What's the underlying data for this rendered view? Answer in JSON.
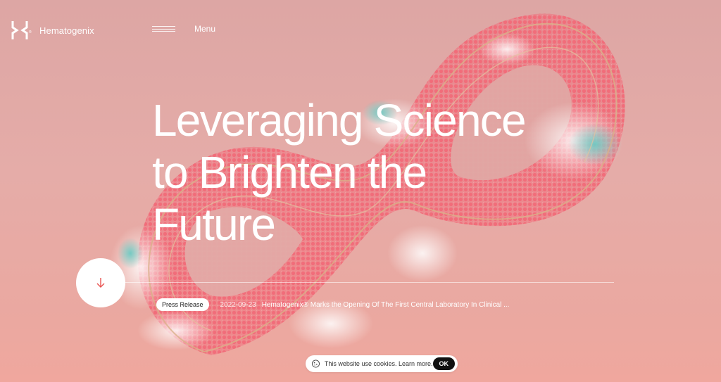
{
  "brand": {
    "name": "Hematogenix"
  },
  "nav": {
    "menu_label": "Menu",
    "menu_icon": "hamburger-icon"
  },
  "hero": {
    "title_lines": [
      "Leveraging Science",
      "to Brighten the",
      "Future"
    ],
    "scroll_icon": "arrow-down-icon"
  },
  "news": {
    "badge": "Press Release",
    "date": "2022-09-23",
    "headline": "Hematogenix® Marks the Opening Of The First Central Laboratory In Clinical ..."
  },
  "cookie": {
    "icon": "cookie-icon",
    "message": "This website use cookies. Learn more.",
    "ok_label": "OK"
  },
  "colors": {
    "background": "#e5aca8",
    "art_coral": "#f06473",
    "art_teal": "#5ec9c1",
    "accent_arrow": "#e8524f"
  }
}
